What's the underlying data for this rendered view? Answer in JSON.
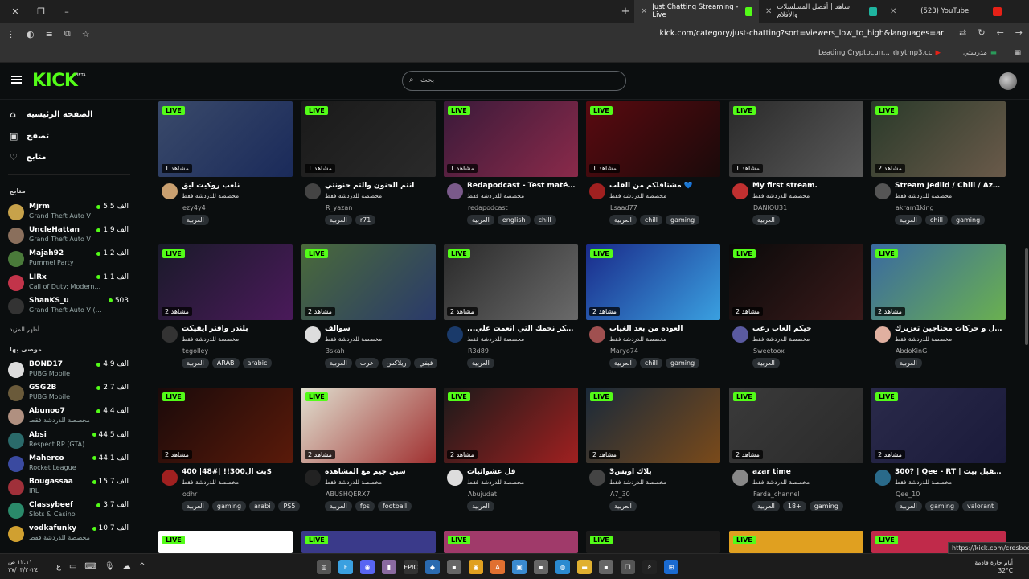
{
  "browser": {
    "tabs": [
      {
        "title": "Just Chatting Streaming - Live",
        "active": true,
        "favicon_color": "#53fc18"
      },
      {
        "title": "شاهد | أفضل المسلسلات والأفلام",
        "active": false,
        "favicon_color": "#1fb5a0"
      },
      {
        "title": "(523) YouTube",
        "active": false,
        "favicon_color": "#e62117"
      }
    ],
    "url": "kick.com/category/just-chatting?sort=viewers_low_to_high&languages=ar",
    "bookmarks": [
      "Leading Cryptocurr...",
      "ytmp3.cc",
      "مدرستي"
    ]
  },
  "kick": {
    "logo": "KICK",
    "beta": "BETA",
    "search_placeholder": "بحث"
  },
  "sidebar": {
    "nav": [
      {
        "label": "الصفحة الرئيسية",
        "icon": "home-icon",
        "glyph": "⌂"
      },
      {
        "label": "تصفح",
        "icon": "browse-icon",
        "glyph": "▣"
      },
      {
        "label": "متابع",
        "icon": "heart-icon",
        "glyph": "♡"
      }
    ],
    "following_header": "متابع",
    "following": [
      {
        "name": "Mjrm",
        "game": "Grand Theft Auto V",
        "viewers": "5.5 الف",
        "color": "#c7a24a"
      },
      {
        "name": "UncleHattan",
        "game": "Grand Theft Auto V",
        "viewers": "1.9 الف",
        "color": "#8a6f5c"
      },
      {
        "name": "Majah92",
        "game": "Pummel Party",
        "viewers": "1.2 الف",
        "color": "#4a7a3a"
      },
      {
        "name": "LIRx",
        "game": "Call of Duty: Modern...",
        "viewers": "1.1 الف",
        "color": "#c2344a"
      },
      {
        "name": "ShanKS_u",
        "game": "Grand Theft Auto V (G...",
        "viewers": "503",
        "color": "#333333"
      }
    ],
    "show_more": "أظهر المزيد",
    "recommended_header": "موصى بها",
    "recommended": [
      {
        "name": "BOND17",
        "game": "PUBG Mobile",
        "viewers": "4.9 الف",
        "color": "#ddd"
      },
      {
        "name": "GSG2B",
        "game": "PUBG Mobile",
        "viewers": "2.7 الف",
        "color": "#6a5a3a"
      },
      {
        "name": "Abunoo7",
        "game": "مخصصة للدردشة فقط",
        "viewers": "4.4 الف",
        "color": "#b09080"
      },
      {
        "name": "Absi",
        "game": "Respect RP (GTA)",
        "viewers": "44.5 الف",
        "color": "#2a6a6a"
      },
      {
        "name": "Maherco",
        "game": "Rocket League",
        "viewers": "44.1 الف",
        "color": "#3a4aa0"
      },
      {
        "name": "Bougassaa",
        "game": "IRL",
        "viewers": "15.7 الف",
        "color": "#a0303a"
      },
      {
        "name": "Classybeef",
        "game": "Slots & Casino",
        "viewers": "3.7 الف",
        "color": "#2a8a6a"
      },
      {
        "name": "vodkafunky",
        "game": "مخصصة للدردشة فقط",
        "viewers": "10.7 الف",
        "color": "#d0a030"
      }
    ]
  },
  "streams": [
    {
      "title": "نلعب روكيت ليق",
      "category": "مخصصة للدردشة فقط",
      "user": "ezy4y4",
      "viewers": "1 مشاهد",
      "tags": [
        "العربية"
      ],
      "bg": "#3a4a6a",
      "bg2": "#1a2a5a",
      "av": "#c9a070"
    },
    {
      "title": "انتم الحنون والتم حنونتي",
      "category": "مخصصة للدردشة فقط",
      "user": "R_yazan",
      "viewers": "1 مشاهد",
      "tags": [
        "العربية",
        "r71"
      ],
      "bg": "#1a1a1a",
      "bg2": "#2a2a2a",
      "av": "#444"
    },
    {
      "title": "Redapodcast - Test matér...",
      "category": "مخصصة للدردشة فقط",
      "user": "redapodcast",
      "viewers": "1 مشاهد",
      "tags": [
        "العربية",
        "english",
        "chill"
      ],
      "bg": "#3a1a3a",
      "bg2": "#8a2a4a",
      "av": "#7a5a8a"
    },
    {
      "title": "مشتاقلكم من القلب 💙",
      "category": "مخصصة للدردشة فقط",
      "user": "Lsaad77",
      "viewers": "1 مشاهد",
      "tags": [
        "العربية",
        "chill",
        "gaming"
      ],
      "bg": "#5a0a10",
      "bg2": "#1a0a0a",
      "av": "#a02020"
    },
    {
      "title": "My first stream.",
      "category": "مخصصة للدردشة فقط",
      "user": "DANIOU31",
      "viewers": "1 مشاهد",
      "tags": [
        "العربية"
      ],
      "bg": "#2a2a2a",
      "bg2": "#5a5a5a",
      "av": "#c03030"
    },
    {
      "title": "Stream Jediid / Chill / Aza...",
      "category": "مخصصة للدردشة فقط",
      "user": "akram1king",
      "viewers": "2 مشاهد",
      "tags": [
        "العربية",
        "chill",
        "gaming"
      ],
      "bg": "#2a3a2a",
      "bg2": "#6a5a4a",
      "av": "#555"
    },
    {
      "title": "بلندر وافتر ايفيكت",
      "category": "مخصصة للدردشة فقط",
      "user": "tegolley",
      "viewers": "2 مشاهد",
      "tags": [
        "العربية",
        "ARAB",
        "arabic"
      ],
      "bg": "#1a1a2a",
      "bg2": "#4a1a5a",
      "av": "#333"
    },
    {
      "title": "سوالف",
      "category": "مخصصة للدردشة فقط",
      "user": "3skah",
      "viewers": "2 مشاهد",
      "tags": [
        "العربية",
        "عرب",
        "ريلاكس",
        "فيفي"
      ],
      "bg": "#4a6a3a",
      "bg2": "#2a3a6a",
      "av": "#ddd"
    },
    {
      "title": "...علي أن أشكر نحمك التي أنعمت علي",
      "category": "مخصصة للدردشة فقط",
      "user": "R3d89",
      "viewers": "2 مشاهد",
      "tags": [
        "العربية"
      ],
      "bg": "#2a2a2a",
      "bg2": "#6a6a6a",
      "av": "#1a3a6a"
    },
    {
      "title": "العوده من بعد الغياب",
      "category": "مخصصة للدردشة فقط",
      "user": "Maryo74",
      "viewers": "2 مشاهد",
      "tags": [
        "العربية",
        "chill",
        "gaming"
      ],
      "bg": "#1a2a8a",
      "bg2": "#3aa0e0",
      "av": "#a05050"
    },
    {
      "title": "حيكم العاب رعب",
      "category": "مخصصة للدردشة فقط",
      "user": "Sweetoox",
      "viewers": "2 مشاهد",
      "tags": [
        "العربية"
      ],
      "bg": "#0a0a0a",
      "bg2": "#3a1a1a",
      "av": "#5a5aa0"
    },
    {
      "title": "جدول و حركات محتاجين تعزيزك",
      "category": "مخصصة للدردشة فقط",
      "user": "AbdoKinG",
      "viewers": "2 مشاهد",
      "tags": [
        "العربية"
      ],
      "bg": "#3a6aa0",
      "bg2": "#6ab050",
      "av": "#e0b0a0"
    },
    {
      "title": "بث ال300!! |#48| 400$",
      "category": "مخصصة للدردشة فقط",
      "user": "odhr",
      "viewers": "2 مشاهد",
      "tags": [
        "العربية",
        "gaming",
        "arabi",
        "PS5"
      ],
      "bg": "#1a0a0a",
      "bg2": "#5a1a0a",
      "av": "#a02020"
    },
    {
      "title": "سين جيم مع المشاهدة",
      "category": "مخصصة للدردشة فقط",
      "user": "ABUSHQERX7",
      "viewers": "2 مشاهد",
      "tags": [
        "العربية",
        "fps",
        "football"
      ],
      "bg": "#e0e0d0",
      "bg2": "#a03030",
      "av": "#222"
    },
    {
      "title": "قل عشوائيات",
      "category": "مخصصة للدردشة فقط",
      "user": "Abujudat",
      "viewers": "2 مشاهد",
      "tags": [
        "العربية"
      ],
      "bg": "#1a1a1a",
      "bg2": "#a02020",
      "av": "#ddd"
    },
    {
      "title": "بلاك اوبس3",
      "category": "مخصصة للدردشة فقط",
      "user": "A7_30",
      "viewers": "2 مشاهد",
      "tags": [
        "العربية"
      ],
      "bg": "#1a2a3a",
      "bg2": "#7a4a1a",
      "av": "#444"
    },
    {
      "title": "azar time",
      "category": "مخصصة للدردشة فقط",
      "user": "Farda_channel",
      "viewers": "2 مشاهد",
      "tags": [
        "العربية",
        "18+",
        "gaming"
      ],
      "bg": "#3a3a3a",
      "bg2": "#2a2a2a",
      "av": "#888"
    },
    {
      "title": "300? | Qee - RT | المستقبل بيت",
      "category": "مخصصة للدردشة فقط",
      "user": "Qee_10",
      "viewers": "2 مشاهد",
      "tags": [
        "العربية",
        "gaming",
        "valorant"
      ],
      "bg": "#2a2a4a",
      "bg2": "#1a1a3a",
      "av": "#2a6a8a"
    }
  ],
  "bottom_row_bgs": [
    "#ffffff",
    "#3a3a8a",
    "#a03a6a",
    "#1a1a1a",
    "#e0a020",
    "#c02a4a"
  ],
  "live_label": "LIVE",
  "status_url": "https://kick.com/cresboo",
  "taskbar": {
    "time": "١٢:١١ ص",
    "date": "٢٧/٠٣/٢٠٢٤",
    "weather_text": "أيام حارة قادمة",
    "temperature": "32°C"
  }
}
